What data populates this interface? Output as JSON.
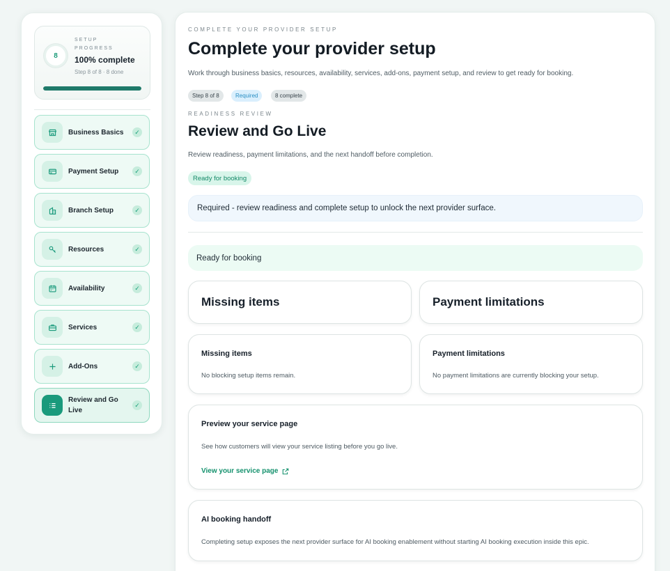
{
  "sidebar": {
    "progress": {
      "step_number": "8",
      "label": "SETUP PROGRESS",
      "percent_text": "100% complete",
      "subtext": "Step 8 of 8 · 8 done",
      "fill_fraction": 1.0
    },
    "steps": [
      {
        "label": "Business Basics",
        "icon": "storefront-icon",
        "status": "complete"
      },
      {
        "label": "Payment Setup",
        "icon": "credit-card-icon",
        "status": "complete"
      },
      {
        "label": "Branch Setup",
        "icon": "building-icon",
        "status": "complete"
      },
      {
        "label": "Resources",
        "icon": "wrench-icon",
        "status": "complete"
      },
      {
        "label": "Availability",
        "icon": "calendar-icon",
        "status": "complete"
      },
      {
        "label": "Services",
        "icon": "briefcase-icon",
        "status": "complete"
      },
      {
        "label": "Add-Ons",
        "icon": "plus-icon",
        "status": "complete"
      },
      {
        "label": "Review and Go Live",
        "icon": "checklist-icon",
        "status": "active"
      }
    ],
    "check_glyph": "✓"
  },
  "main": {
    "eyebrow": "COMPLETE YOUR PROVIDER SETUP",
    "title": "Complete your provider setup",
    "lead": "Work through business basics, resources, availability, services, add-ons, payment setup, and review to get ready for booking.",
    "chips": [
      "Step 8 of 8",
      "Required",
      "8 complete"
    ],
    "section_eyebrow": "READINESS REVIEW",
    "section_title": "Review and Go Live",
    "section_sub": "Review readiness, payment limitations, and the next handoff before completion.",
    "status_pill": "Ready for booking",
    "required_banner": "Required - review readiness and complete setup to unlock the next provider surface.",
    "ready_banner": "Ready for booking",
    "summary_cards": {
      "missing_title": "Missing items",
      "payment_title": "Payment limitations"
    },
    "detail_cards": {
      "missing": {
        "title": "Missing items",
        "text": "No blocking setup items remain."
      },
      "payment": {
        "title": "Payment limitations",
        "text": "No payment limitations are currently blocking your setup."
      }
    },
    "preview": {
      "title": "Preview your service page",
      "text": "See how customers will view your service listing before you go live.",
      "link": "View your service page"
    },
    "handoff": {
      "title": "AI booking handoff",
      "text": "Completing setup exposes the next provider surface for AI booking enablement without starting AI booking execution inside this epic."
    }
  },
  "colors": {
    "accent": "#1a9a7c",
    "accent_dark": "#1f7a6a",
    "link": "#14916d",
    "step_bg": "#eefaf5",
    "step_border": "#a7e3ce",
    "required_chip": "#2a8fc4"
  }
}
